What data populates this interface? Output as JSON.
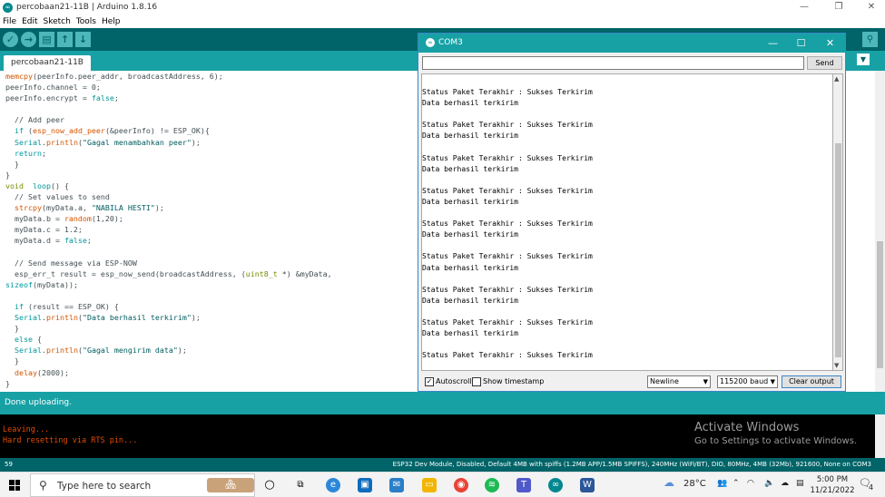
{
  "window": {
    "title": "percobaan21-11B | Arduino 1.8.16"
  },
  "menu": [
    "File",
    "Edit",
    "Sketch",
    "Tools",
    "Help"
  ],
  "editor_tab": "percobaan21-11B",
  "status": "Done uploading.",
  "console": [
    "Leaving...",
    "Hard resetting via RTS pin..."
  ],
  "activate": {
    "line1": "Activate Windows",
    "line2": "Go to Settings to activate Windows."
  },
  "board": {
    "line_no": "59",
    "info": "ESP32 Dev Module, Disabled, Default 4MB with spiffs (1.2MB APP/1.5MB SPIFFS), 240MHz (WiFi/BT), DIO, 80MHz, 4MB (32Mb), 921600, None on COM3"
  },
  "serial": {
    "title": "COM3",
    "send_label": "Send",
    "input_value": "",
    "output": [
      "Status Paket Terakhir : Sukses Terkirim",
      "Data berhasil terkirim",
      "",
      "Status Paket Terakhir : Sukses Terkirim",
      "Data berhasil terkirim",
      "",
      "Status Paket Terakhir : Sukses Terkirim",
      "Data berhasil terkirim",
      "",
      "Status Paket Terakhir : Sukses Terkirim",
      "Data berhasil terkirim",
      "",
      "Status Paket Terakhir : Sukses Terkirim",
      "Data berhasil terkirim",
      "",
      "Status Paket Terakhir : Sukses Terkirim",
      "Data berhasil terkirim",
      "",
      "Status Paket Terakhir : Sukses Terkirim",
      "Data berhasil terkirim",
      "",
      "Status Paket Terakhir : Sukses Terkirim",
      "Data berhasil terkirim",
      "",
      "Status Paket Terakhir : Sukses Terkirim"
    ],
    "autoscroll_label": "Autoscroll",
    "autoscroll_checked": true,
    "timestamp_label": "Show timestamp",
    "timestamp_checked": false,
    "line_ending": "Newline",
    "baud": "115200 baud",
    "clear_label": "Clear output"
  },
  "taskbar": {
    "search_placeholder": "Type here to search",
    "weather": "28°C",
    "time": "5:00 PM",
    "date": "11/21/2022",
    "notifications": "4"
  },
  "code": [
    [
      [
        "fn",
        "memcpy"
      ],
      [
        "",
        "(peerInfo.peer_addr, broadcastAddress, 6);"
      ]
    ],
    [
      [
        "",
        "peerInfo.channel = 0;"
      ]
    ],
    [
      [
        "",
        "peerInfo.encrypt = "
      ],
      [
        "kw",
        "false"
      ],
      [
        "",
        ";"
      ]
    ],
    [
      [
        "",
        ""
      ]
    ],
    [
      [
        "cm",
        "  // Add peer"
      ]
    ],
    [
      [
        "",
        "  "
      ],
      [
        "kw",
        "if"
      ],
      [
        "",
        " ("
      ],
      [
        "fn",
        "esp_now_add_peer"
      ],
      [
        "",
        "(&peerInfo) != ESP_OK){"
      ]
    ],
    [
      [
        "",
        "  "
      ],
      [
        "kw",
        "Serial"
      ],
      [
        "",
        "."
      ],
      [
        "fn",
        "println"
      ],
      [
        "",
        "("
      ],
      [
        "str",
        "\"Gagal menambahkan peer\""
      ],
      [
        "",
        ");"
      ]
    ],
    [
      [
        "",
        "  "
      ],
      [
        "kw",
        "return"
      ],
      [
        "",
        ";"
      ]
    ],
    [
      [
        "",
        "  }"
      ]
    ],
    [
      [
        "",
        "}"
      ]
    ],
    [
      [
        "ty",
        "void"
      ],
      [
        "",
        ""
      ],
      [
        "",
        "  "
      ],
      [
        "kw",
        "loop"
      ],
      [
        "",
        "() {"
      ]
    ],
    [
      [
        "cm",
        "  // Set values to send"
      ]
    ],
    [
      [
        "",
        "  "
      ],
      [
        "fn",
        "strcpy"
      ],
      [
        "",
        "(myData.a, "
      ],
      [
        "str",
        "\"NABILA HESTI\""
      ],
      [
        "",
        ");"
      ]
    ],
    [
      [
        "",
        "  myData.b = "
      ],
      [
        "fn",
        "random"
      ],
      [
        "",
        "(1,20);"
      ]
    ],
    [
      [
        "",
        "  myData.c = 1.2;"
      ]
    ],
    [
      [
        "",
        "  myData.d = "
      ],
      [
        "kw",
        "false"
      ],
      [
        "",
        ";"
      ]
    ],
    [
      [
        "",
        ""
      ]
    ],
    [
      [
        "cm",
        "  // Send message via ESP-NOW"
      ]
    ],
    [
      [
        "",
        "  esp_err_t result = esp_now_send(broadcastAddress, ("
      ],
      [
        "ty",
        "uint8_t"
      ],
      [
        "",
        " *) &myData,"
      ]
    ],
    [
      [
        "kw",
        "sizeof"
      ],
      [
        "",
        "(myData));"
      ]
    ],
    [
      [
        "",
        ""
      ]
    ],
    [
      [
        "",
        "  "
      ],
      [
        "kw",
        "if"
      ],
      [
        "",
        "",
        " (result == ESP_OK) {"
      ]
    ],
    [
      [
        "",
        "  "
      ],
      [
        "kw",
        "Serial"
      ],
      [
        "",
        "."
      ],
      [
        "fn",
        "println"
      ],
      [
        "",
        "("
      ],
      [
        "str",
        "\"Data berhasil terkirim\""
      ],
      [
        "",
        ");"
      ]
    ],
    [
      [
        "",
        "  }"
      ]
    ],
    [
      [
        "",
        "  "
      ],
      [
        "kw",
        "else"
      ],
      [
        "",
        " {"
      ]
    ],
    [
      [
        "",
        "  "
      ],
      [
        "kw",
        "Serial"
      ],
      [
        "",
        "."
      ],
      [
        "fn",
        "println"
      ],
      [
        "",
        "("
      ],
      [
        "str",
        "\"Gagal mengirim data\""
      ],
      [
        "",
        ");"
      ]
    ],
    [
      [
        "",
        "  }"
      ]
    ],
    [
      [
        "",
        "  "
      ],
      [
        "fn",
        "delay"
      ],
      [
        "",
        "(2000);"
      ]
    ],
    [
      [
        "",
        "}"
      ]
    ]
  ]
}
